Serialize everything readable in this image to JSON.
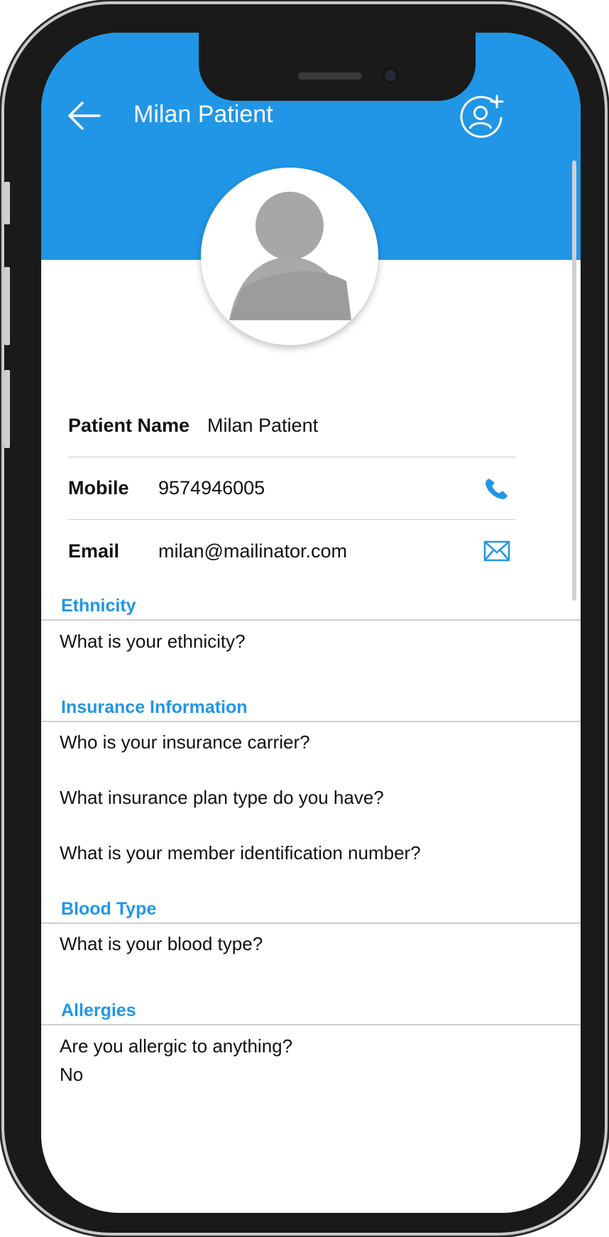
{
  "header": {
    "title": "Milan Patient",
    "back_icon": "arrow-left-icon",
    "add_icon": "add-user-icon",
    "color": "#2196e6"
  },
  "profile": {
    "patient_name_label": "Patient Name",
    "patient_name": "Milan Patient",
    "mobile_label": "Mobile",
    "mobile": "9574946005",
    "email_label": "Email",
    "email": "milan@mailinator.com"
  },
  "sections": [
    {
      "title": "Ethnicity",
      "questions": [
        "What is your ethnicity?"
      ]
    },
    {
      "title": "Insurance Information",
      "questions": [
        "Who is your insurance carrier?",
        "What insurance plan type do you have?",
        "What is your member identification number?"
      ]
    },
    {
      "title": "Blood Type",
      "questions": [
        "What is your blood type?"
      ]
    },
    {
      "title": "Allergies",
      "questions": [
        "Are you allergic to anything?"
      ],
      "answer": "No"
    }
  ]
}
